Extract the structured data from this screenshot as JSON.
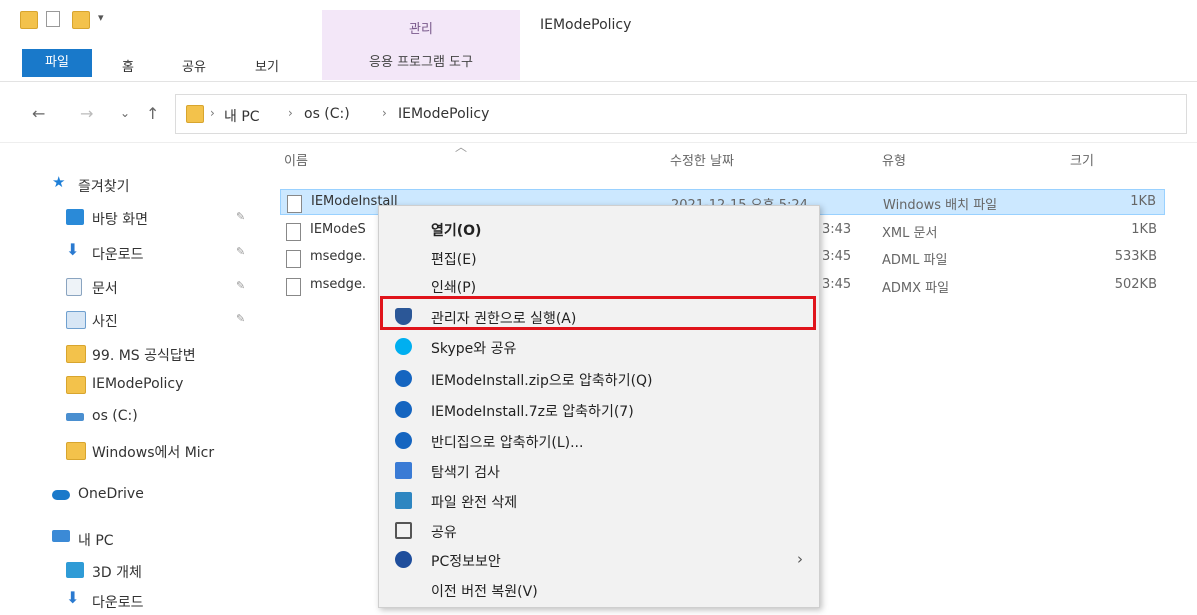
{
  "window": {
    "title": "IEModePolicy",
    "context_tab_group": "관리"
  },
  "ribbon": {
    "tabs": {
      "file": "파일",
      "home": "홈",
      "share": "공유",
      "view": "보기",
      "app_tools": "응용 프로그램 도구"
    }
  },
  "address": {
    "back": "←",
    "forward": "→",
    "recent": "⌄",
    "up": "↑",
    "crumbs": [
      "내 PC",
      "os (C:)",
      "IEModePolicy"
    ],
    "separator": "›"
  },
  "nav_pane": {
    "items": [
      {
        "label": "즐겨찾기",
        "icon": "star-icon",
        "color": "#1e7fd8"
      },
      {
        "label": "바탕 화면",
        "icon": "desktop-icon",
        "color": "#2a8ad8",
        "pinned": true
      },
      {
        "label": "다운로드",
        "icon": "download-icon",
        "color": "#2a7ad0",
        "pinned": true
      },
      {
        "label": "문서",
        "icon": "document-icon",
        "color": "#8aa4c0",
        "pinned": true
      },
      {
        "label": "사진",
        "icon": "pictures-icon",
        "color": "#6fa0cf",
        "pinned": true
      },
      {
        "label": "99. MS 공식답변",
        "icon": "folder-icon",
        "color": "#f3c24b"
      },
      {
        "label": "IEModePolicy",
        "icon": "folder-icon",
        "color": "#f3c24b"
      },
      {
        "label": "os (C:)",
        "icon": "drive-icon",
        "color": "#4a8fd0"
      },
      {
        "label": "Windows에서 Micr",
        "icon": "folder-icon",
        "color": "#f3c24b"
      },
      {
        "label": "OneDrive",
        "icon": "cloud-icon",
        "color": "#1979ca"
      },
      {
        "label": "내 PC",
        "icon": "computer-icon",
        "color": "#3b8ad6"
      },
      {
        "label": "3D 개체",
        "icon": "3d-objects-icon",
        "color": "#2f9bd6"
      },
      {
        "label": "다운로드",
        "icon": "download-icon",
        "color": "#2a7ad0"
      }
    ],
    "pin_glyph": "✎"
  },
  "file_list": {
    "columns": {
      "name": "이름",
      "date": "수정한 날짜",
      "type": "유형",
      "size": "크기"
    },
    "rows": [
      {
        "name": "IEModeInstall",
        "date": "2021-12-15 오후 5:24",
        "type": "Windows 배치 파일",
        "size": "1KB",
        "selected": true
      },
      {
        "name": "IEModeS",
        "date": "3:43",
        "type": "XML 문서",
        "size": "1KB"
      },
      {
        "name": "msedge.",
        "date": "3:45",
        "type": "ADML 파일",
        "size": "533KB"
      },
      {
        "name": "msedge.",
        "date": "3:45",
        "type": "ADMX 파일",
        "size": "502KB"
      }
    ]
  },
  "context_menu": {
    "items": [
      {
        "label": "열기(O)",
        "bold": true
      },
      {
        "label": "편집(E)"
      },
      {
        "label": "인쇄(P)"
      },
      {
        "label": "관리자 권한으로 실행(A)",
        "icon": "shield-icon",
        "color": "#2b5797"
      },
      {
        "label": "Skype와 공유",
        "icon": "skype-icon",
        "color": "#00aff0"
      },
      {
        "label": "IEModeInstall.zip으로 압축하기(Q)",
        "icon": "bandizip-icon",
        "color": "#1565c0"
      },
      {
        "label": "IEModeInstall.7z로 압축하기(7)",
        "icon": "bandizip-icon",
        "color": "#1565c0"
      },
      {
        "label": "반디집으로 압축하기(L)...",
        "icon": "bandizip-icon",
        "color": "#1565c0"
      },
      {
        "label": "탐색기 검사",
        "icon": "scan-icon",
        "color": "#3a7bd5"
      },
      {
        "label": "파일 완전 삭제",
        "icon": "shred-icon",
        "color": "#2e86c1"
      },
      {
        "label": "공유",
        "icon": "share-icon",
        "color": "#555555"
      },
      {
        "label": "PC정보보안",
        "icon": "security-icon",
        "color": "#1f4e9c",
        "submenu": true
      },
      {
        "label": "이전 버전 복원(V)"
      }
    ],
    "submenu_arrow": "›",
    "highlight_color": "#e0141b"
  }
}
